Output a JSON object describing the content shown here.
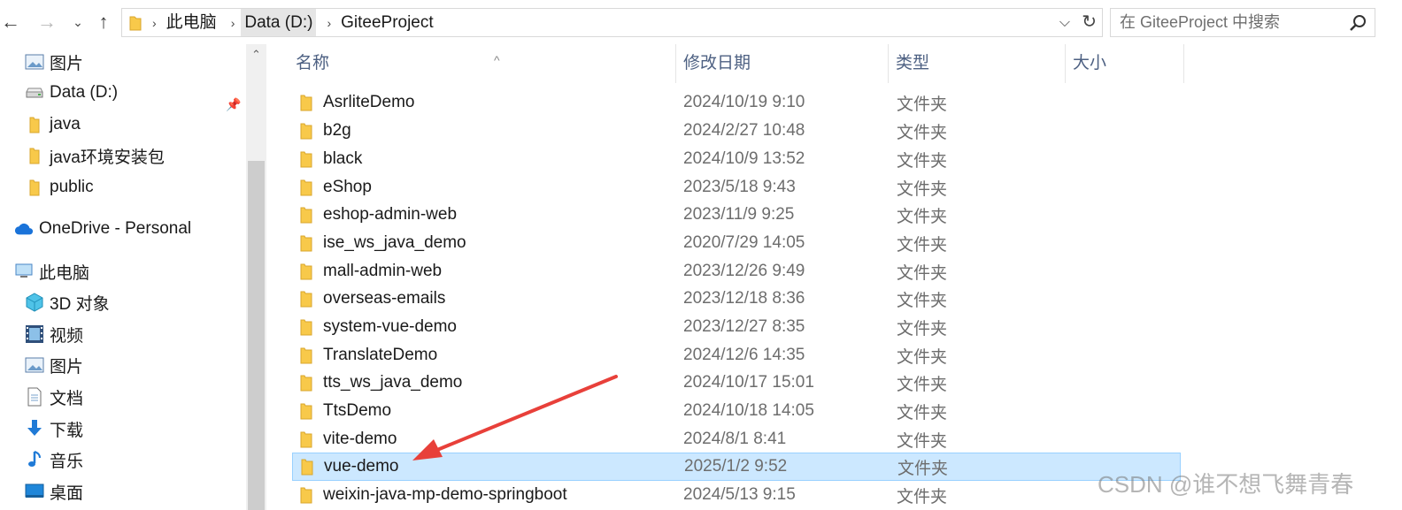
{
  "address": {
    "crumbs": [
      "此电脑",
      "Data (D:)",
      "GiteeProject"
    ],
    "dropdown_glyph": "⌵",
    "refresh_glyph": "↻"
  },
  "search": {
    "placeholder": "在 GiteeProject 中搜索"
  },
  "nav": {
    "quick_access": [
      {
        "label": "图片",
        "icon": "pictures-icon"
      },
      {
        "label": "Data (D:)",
        "icon": "drive-icon"
      },
      {
        "label": "java",
        "icon": "folder-icon"
      },
      {
        "label": "java环境安装包",
        "icon": "folder-icon"
      },
      {
        "label": "public",
        "icon": "folder-icon"
      }
    ],
    "onedrive": "OneDrive - Personal",
    "this_pc": "此电脑",
    "this_pc_items": [
      {
        "label": "3D 对象",
        "icon": "3d-objects-icon"
      },
      {
        "label": "视频",
        "icon": "videos-icon"
      },
      {
        "label": "图片",
        "icon": "pictures-icon"
      },
      {
        "label": "文档",
        "icon": "documents-icon"
      },
      {
        "label": "下载",
        "icon": "downloads-icon"
      },
      {
        "label": "音乐",
        "icon": "music-icon"
      },
      {
        "label": "桌面",
        "icon": "desktop-icon"
      }
    ]
  },
  "columns": {
    "name": "名称",
    "date": "修改日期",
    "type": "类型",
    "size": "大小"
  },
  "files": [
    {
      "name": "AsrliteDemo",
      "date": "2024/10/19 9:10",
      "type": "文件夹"
    },
    {
      "name": "b2g",
      "date": "2024/2/27 10:48",
      "type": "文件夹"
    },
    {
      "name": "black",
      "date": "2024/10/9 13:52",
      "type": "文件夹"
    },
    {
      "name": "eShop",
      "date": "2023/5/18 9:43",
      "type": "文件夹"
    },
    {
      "name": "eshop-admin-web",
      "date": "2023/11/9 9:25",
      "type": "文件夹"
    },
    {
      "name": "ise_ws_java_demo",
      "date": "2020/7/29 14:05",
      "type": "文件夹"
    },
    {
      "name": "mall-admin-web",
      "date": "2023/12/26 9:49",
      "type": "文件夹"
    },
    {
      "name": "overseas-emails",
      "date": "2023/12/18 8:36",
      "type": "文件夹"
    },
    {
      "name": "system-vue-demo",
      "date": "2023/12/27 8:35",
      "type": "文件夹"
    },
    {
      "name": "TranslateDemo",
      "date": "2024/12/6 14:35",
      "type": "文件夹"
    },
    {
      "name": "tts_ws_java_demo",
      "date": "2024/10/17 15:01",
      "type": "文件夹"
    },
    {
      "name": "TtsDemo",
      "date": "2024/10/18 14:05",
      "type": "文件夹"
    },
    {
      "name": "vite-demo",
      "date": "2024/8/1 8:41",
      "type": "文件夹"
    },
    {
      "name": "vue-demo",
      "date": "2025/1/2 9:52",
      "type": "文件夹",
      "selected": true
    },
    {
      "name": "weixin-java-mp-demo-springboot",
      "date": "2024/5/13 9:15",
      "type": "文件夹"
    }
  ],
  "watermark": "CSDN @谁不想飞舞青春",
  "colors": {
    "selection": "#cce8ff",
    "arrow": "#e8403a",
    "folder": "#f8c94a"
  }
}
